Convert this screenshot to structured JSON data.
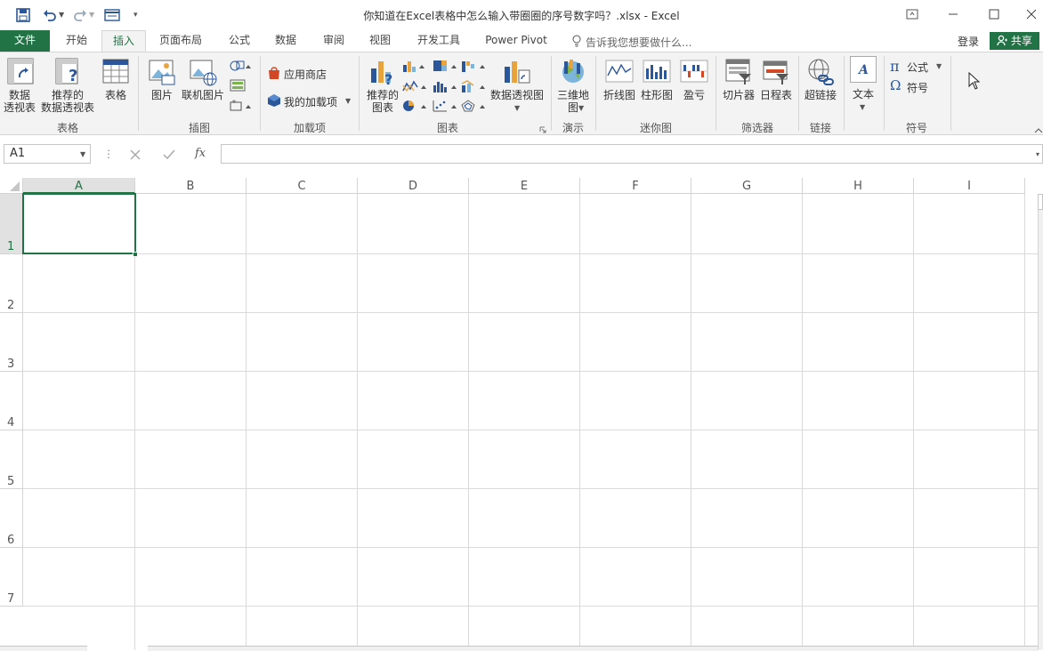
{
  "window": {
    "title": "你知道在Excel表格中怎么输入带圈圈的序号数字吗？.xlsx - Excel"
  },
  "tabs": [
    "文件",
    "开始",
    "插入",
    "页面布局",
    "公式",
    "数据",
    "审阅",
    "视图",
    "开发工具",
    "Power Pivot"
  ],
  "tell_me": "告诉我您想要做什么...",
  "account": {
    "login": "登录",
    "share": "共享"
  },
  "ribbon": {
    "table_group": {
      "label": "表格",
      "pivot": "数据\n透视表",
      "recommended_pivot": "推荐的\n数据透视表",
      "table": "表格"
    },
    "illustrations_group": {
      "label": "插图",
      "pictures": "图片",
      "online_pictures": "联机图片"
    },
    "addins_group": {
      "label": "加载项",
      "store": "应用商店",
      "my_addins": "我的加载项"
    },
    "charts_group": {
      "label": "图表",
      "recommended_charts": "推荐的\n图表",
      "pivot_chart": "数据透视图"
    },
    "tours_group": {
      "label": "演示",
      "map_3d": "三维地\n图"
    },
    "sparklines_group": {
      "label": "迷你图",
      "line": "折线图",
      "column": "柱形图",
      "win_loss": "盈亏"
    },
    "filters_group": {
      "label": "筛选器",
      "slicer": "切片器",
      "timeline": "日程表"
    },
    "links_group": {
      "label": "链接",
      "hyperlink": "超链接"
    },
    "text_group": {
      "text": "文本"
    },
    "symbols_group": {
      "label": "符号",
      "equation": "公式",
      "symbol": "符号"
    }
  },
  "formula_bar": {
    "name_box": "A1",
    "fx": "fx",
    "formula": ""
  },
  "sheet": {
    "columns": [
      "A",
      "B",
      "C",
      "D",
      "E",
      "F",
      "G",
      "H",
      "I"
    ],
    "rows": [
      "1",
      "2",
      "3",
      "4",
      "5",
      "6",
      "7"
    ],
    "selected_cell": "A1"
  },
  "colors": {
    "accent": "#217346",
    "ribbon_bg": "#f3f3f3"
  }
}
